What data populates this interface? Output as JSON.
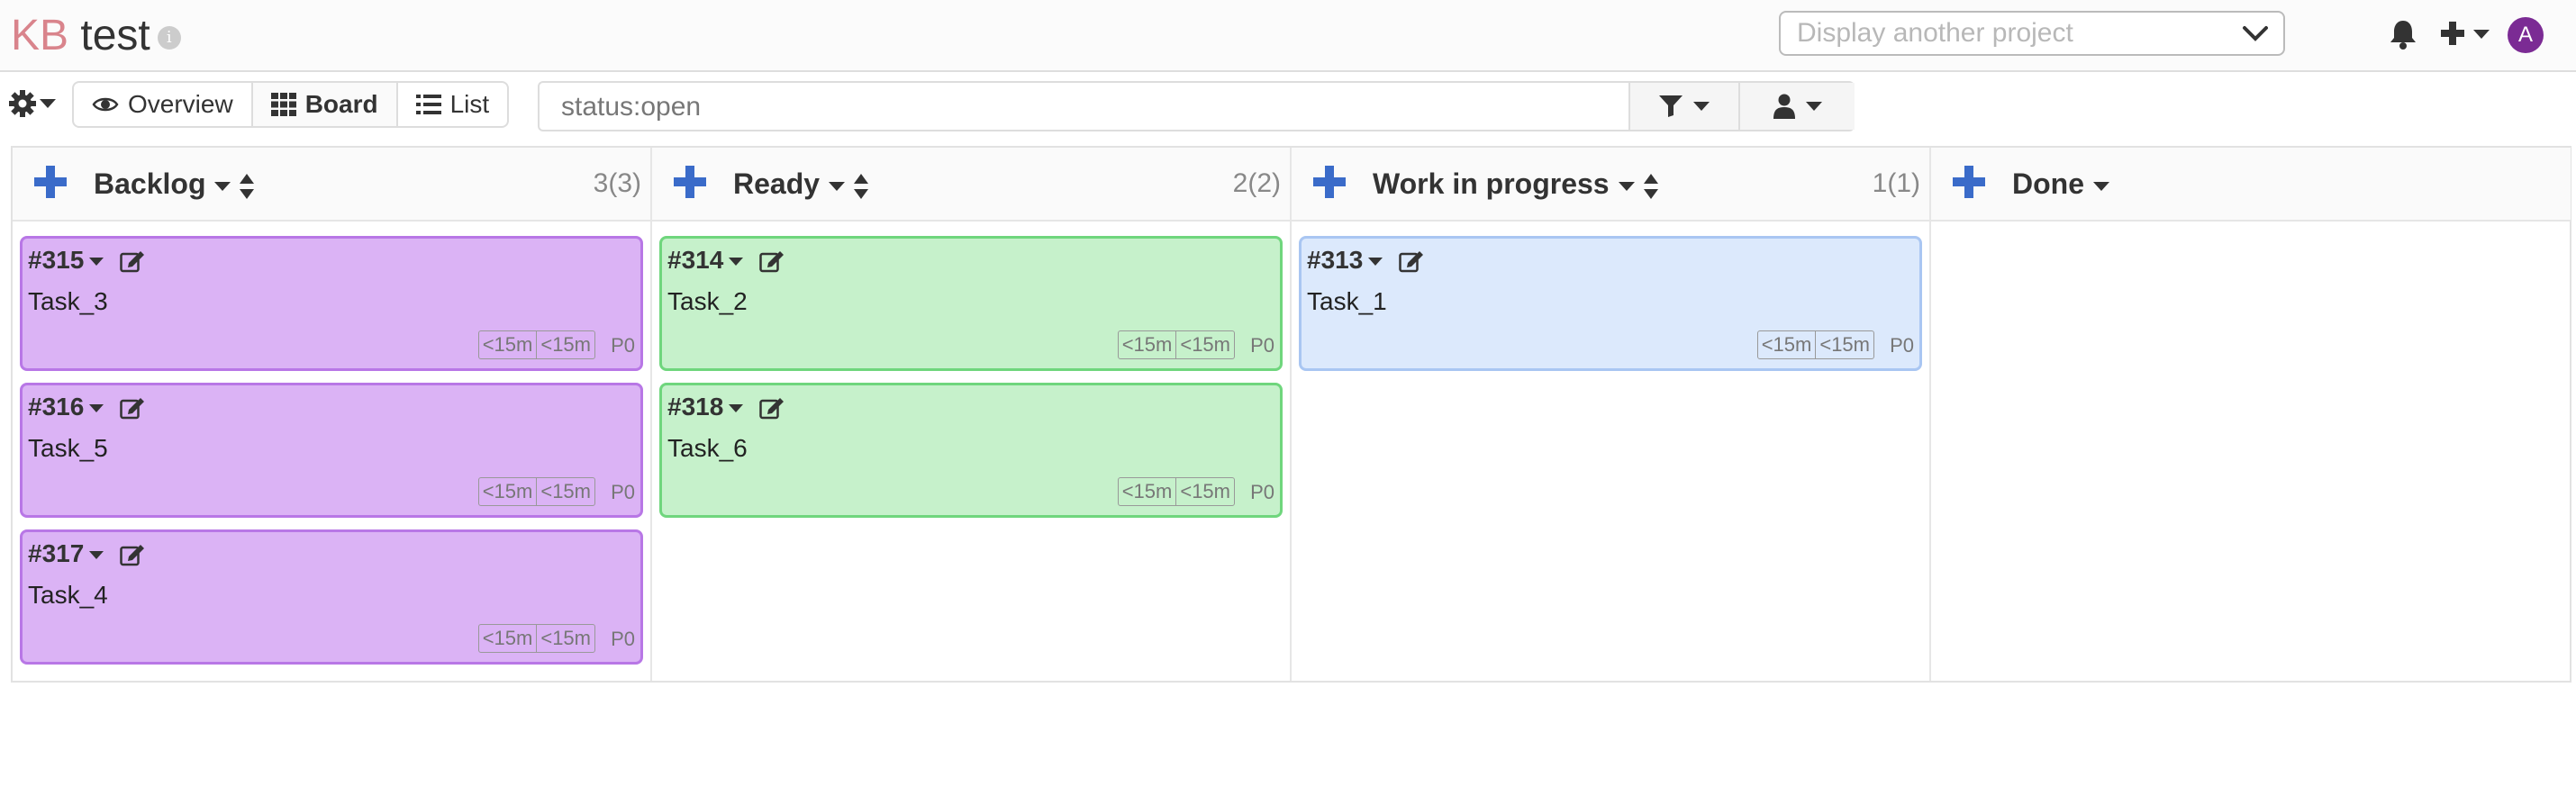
{
  "header": {
    "logo_kb": "KB",
    "project_title": "test",
    "info_glyph": "i",
    "project_select_placeholder": "Display another project",
    "avatar_letter": "A",
    "icons": [
      "info-icon",
      "chevron-down-icon",
      "bell-icon",
      "plus-icon",
      "caret-down-icon"
    ]
  },
  "toolbar": {
    "views": [
      {
        "label": "Overview",
        "icon": "eye-icon",
        "active": false
      },
      {
        "label": "Board",
        "icon": "grid-icon",
        "active": true
      },
      {
        "label": "List",
        "icon": "list-icon",
        "active": false
      }
    ],
    "search_value": "status:open",
    "icons": [
      "gear-icon",
      "filter-icon",
      "user-icon"
    ]
  },
  "colors": {
    "accent_blue": "#3a6bc9",
    "card_purple": "#dbb3f5",
    "card_green": "#c6f1cb",
    "card_blue": "#dce9fc",
    "avatar": "#7b2b94"
  },
  "columns": [
    {
      "title": "Backlog",
      "count": "3(3)",
      "cards": [
        {
          "id": "#315",
          "name": "Task_3",
          "est1": "<15m",
          "est2": "<15m",
          "priority": "P0",
          "color": "purple"
        },
        {
          "id": "#316",
          "name": "Task_5",
          "est1": "<15m",
          "est2": "<15m",
          "priority": "P0",
          "color": "purple"
        },
        {
          "id": "#317",
          "name": "Task_4",
          "est1": "<15m",
          "est2": "<15m",
          "priority": "P0",
          "color": "purple"
        }
      ]
    },
    {
      "title": "Ready",
      "count": "2(2)",
      "cards": [
        {
          "id": "#314",
          "name": "Task_2",
          "est1": "<15m",
          "est2": "<15m",
          "priority": "P0",
          "color": "green"
        },
        {
          "id": "#318",
          "name": "Task_6",
          "est1": "<15m",
          "est2": "<15m",
          "priority": "P0",
          "color": "green"
        }
      ]
    },
    {
      "title": "Work in progress",
      "count": "1(1)",
      "cards": [
        {
          "id": "#313",
          "name": "Task_1",
          "est1": "<15m",
          "est2": "<15m",
          "priority": "P0",
          "color": "blue"
        }
      ]
    },
    {
      "title": "Done",
      "count": "",
      "cards": []
    }
  ]
}
